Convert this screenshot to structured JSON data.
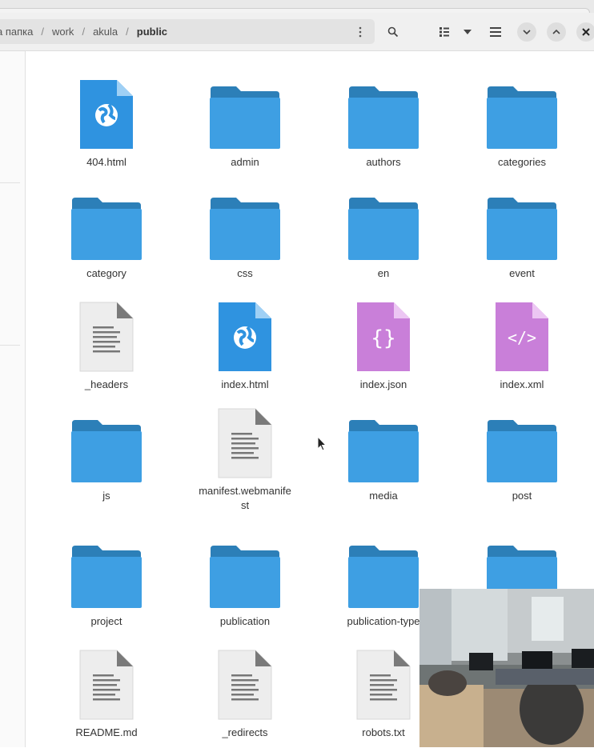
{
  "pathbar": {
    "crumbs": [
      "а папка",
      "work",
      "akula",
      "public"
    ],
    "separator": "/"
  },
  "toolbar": {
    "icons": [
      "more-vertical-icon",
      "search-icon",
      "view-toggle-icon",
      "chevron-down-icon",
      "menu-icon",
      "minimize-icon",
      "maximize-icon",
      "close-icon"
    ]
  },
  "files": [
    {
      "name": "404.html",
      "type": "html"
    },
    {
      "name": "admin",
      "type": "folder"
    },
    {
      "name": "authors",
      "type": "folder"
    },
    {
      "name": "categories",
      "type": "folder"
    },
    {
      "name": "category",
      "type": "folder"
    },
    {
      "name": "css",
      "type": "folder"
    },
    {
      "name": "en",
      "type": "folder"
    },
    {
      "name": "event",
      "type": "folder"
    },
    {
      "name": "_headers",
      "type": "text"
    },
    {
      "name": "index.html",
      "type": "html"
    },
    {
      "name": "index.json",
      "type": "json"
    },
    {
      "name": "index.xml",
      "type": "xml"
    },
    {
      "name": "js",
      "type": "folder"
    },
    {
      "name": "manifest.webmanifest",
      "type": "text"
    },
    {
      "name": "media",
      "type": "folder"
    },
    {
      "name": "post",
      "type": "folder"
    },
    {
      "name": "project",
      "type": "folder"
    },
    {
      "name": "publication",
      "type": "folder"
    },
    {
      "name": "publication-type",
      "type": "folder"
    },
    {
      "name": "",
      "type": "folder"
    },
    {
      "name": "README.md",
      "type": "text"
    },
    {
      "name": "_redirects",
      "type": "text"
    },
    {
      "name": "robots.txt",
      "type": "text"
    }
  ],
  "colors": {
    "folder_body": "#3e9fe3",
    "folder_tab": "#2c7fb8",
    "html_file": "#2f93e0",
    "code_file": "#c97fd9",
    "text_file": "#ededed"
  }
}
